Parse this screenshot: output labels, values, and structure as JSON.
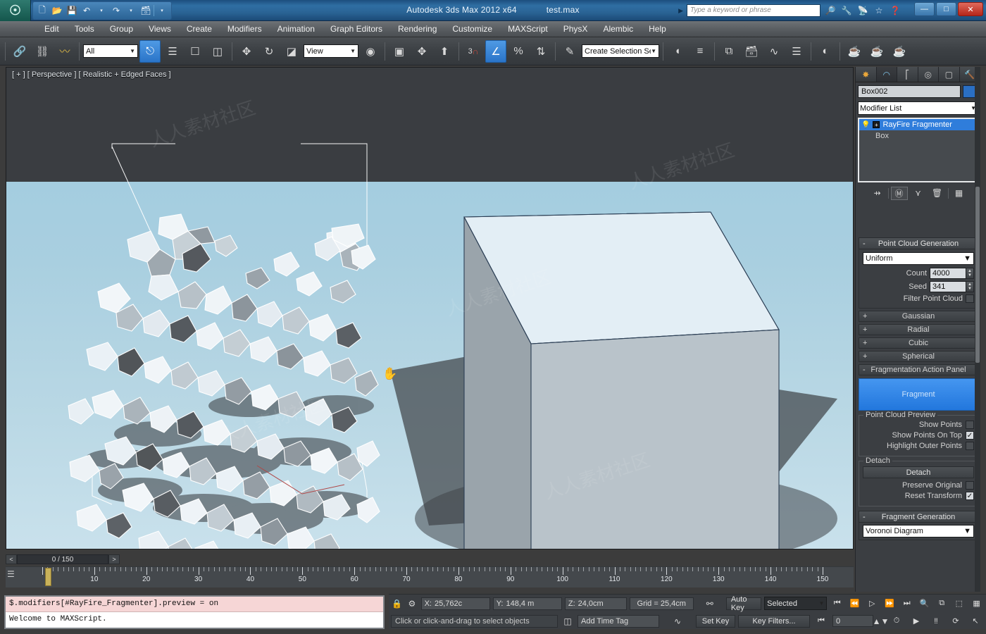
{
  "titlebar": {
    "app_title": "Autodesk 3ds Max  2012 x64",
    "file_name": "test.max",
    "logo": "3ds-max-logo",
    "search_placeholder": "Type a keyword or phrase",
    "quick_access": [
      {
        "name": "new-file-icon",
        "glyph": "⬜"
      },
      {
        "name": "open-file-icon",
        "glyph": "📂"
      },
      {
        "name": "save-file-icon",
        "glyph": "💾"
      },
      {
        "name": "undo-icon",
        "glyph": "↶"
      },
      {
        "name": "undo-dropdown-icon",
        "glyph": "▾"
      },
      {
        "name": "redo-icon",
        "glyph": "↷"
      },
      {
        "name": "redo-dropdown-icon",
        "glyph": "▾"
      },
      {
        "name": "project-folder-icon",
        "glyph": "🗂"
      },
      {
        "name": "qat-customize-icon",
        "glyph": "▾"
      }
    ],
    "title_icons": [
      {
        "name": "binoculars-icon",
        "glyph": "🔍"
      },
      {
        "name": "search-tools-icon",
        "glyph": "🔧"
      },
      {
        "name": "satellite-icon",
        "glyph": "📡"
      },
      {
        "name": "favorites-star-icon",
        "glyph": "★"
      },
      {
        "name": "help-icon",
        "glyph": "?"
      }
    ],
    "window_buttons": [
      {
        "name": "minimize-button",
        "glyph": "—"
      },
      {
        "name": "maximize-button",
        "glyph": "□"
      },
      {
        "name": "close-button",
        "glyph": "✕"
      }
    ]
  },
  "menubar": {
    "items": [
      "Edit",
      "Tools",
      "Group",
      "Views",
      "Create",
      "Modifiers",
      "Animation",
      "Graph Editors",
      "Rendering",
      "Customize",
      "MAXScript",
      "PhysX",
      "Alembic",
      "Help"
    ]
  },
  "toolbar": {
    "selection_filter": "All",
    "reference_coordinate": "View",
    "named_selection_set": "Create Selection Se",
    "snap_percent_label": "%",
    "snap_count_label": "3",
    "buttons": [
      {
        "name": "select-and-link-icon",
        "glyph": "🔗"
      },
      {
        "name": "unlink-selection-icon",
        "glyph": "⛓"
      },
      {
        "name": "bind-to-space-warp-icon",
        "glyph": "〰"
      },
      {
        "name": "select-object-icon",
        "glyph": "⬚",
        "active": true
      },
      {
        "name": "select-by-name-icon",
        "glyph": "☰"
      },
      {
        "name": "rectangular-selection-region-icon",
        "glyph": "⬚"
      },
      {
        "name": "window-crossing-icon",
        "glyph": "◫"
      },
      {
        "name": "select-and-move-icon",
        "glyph": "✥"
      },
      {
        "name": "select-and-rotate-icon",
        "glyph": "↻"
      },
      {
        "name": "select-and-scale-icon",
        "glyph": "◰"
      },
      {
        "name": "mirror-icon",
        "glyph": "◧"
      },
      {
        "name": "align-icon",
        "glyph": "✥"
      },
      {
        "name": "layer-manager-icon",
        "glyph": "⬆"
      },
      {
        "name": "snaps-toggle-icon",
        "glyph": "⌔"
      },
      {
        "name": "angle-snap-toggle-icon",
        "glyph": "∠",
        "active": true
      },
      {
        "name": "percent-snap-toggle-icon",
        "glyph": "⌕"
      },
      {
        "name": "spinner-snap-toggle-icon",
        "glyph": "↕"
      },
      {
        "name": "edit-named-selection-icon",
        "glyph": "✎"
      },
      {
        "name": "mirror-geometry-icon",
        "glyph": "◑"
      },
      {
        "name": "align-tools-icon",
        "glyph": "≡"
      },
      {
        "name": "layer-explorer-icon",
        "glyph": "⧉"
      },
      {
        "name": "scene-explorer-icon",
        "glyph": "🗂"
      },
      {
        "name": "curve-editor-icon",
        "glyph": "∿"
      },
      {
        "name": "schematic-view-icon",
        "glyph": "☰"
      },
      {
        "name": "material-editor-icon",
        "glyph": "◔"
      },
      {
        "name": "render-setup-icon",
        "glyph": "🫖"
      },
      {
        "name": "rendered-frame-window-icon",
        "glyph": "☕"
      },
      {
        "name": "render-production-icon",
        "glyph": "☕"
      }
    ]
  },
  "viewport": {
    "label": "[ + ] [ Perspective ] [ Realistic + Edged Faces ]",
    "cursor": "pan-hand-cursor",
    "sky_color": "#3a3d41",
    "ground_color": "#a9cfe0",
    "cube_top_color": "#e3eef5",
    "cube_front_color": "#b9c3ca",
    "cube_side_color": "#9aa4ab",
    "fragment_light": "#eef4f8",
    "fragment_mid": "#c2ccd3",
    "fragment_dark": "#55595e",
    "edge_color": "#ffffff"
  },
  "command_panel": {
    "tabs": [
      {
        "name": "create-tab",
        "glyph": "☀"
      },
      {
        "name": "modify-tab",
        "glyph": "◠"
      },
      {
        "name": "hierarchy-tab",
        "glyph": "⑂"
      },
      {
        "name": "motion-tab",
        "glyph": "◎"
      },
      {
        "name": "display-tab",
        "glyph": "▢"
      },
      {
        "name": "utilities-tab",
        "glyph": "🔨"
      }
    ],
    "object_name": "Box002",
    "modifier_list_label": "Modifier List",
    "stack": [
      {
        "label": "RayFire Fragmenter",
        "selected": true
      },
      {
        "label": "Box",
        "selected": false
      }
    ],
    "stack_tools": [
      {
        "name": "pin-stack-icon",
        "glyph": "⊸"
      },
      {
        "name": "show-end-result-icon",
        "glyph": "⌶"
      },
      {
        "name": "make-unique-icon",
        "glyph": "⑂"
      },
      {
        "name": "remove-modifier-icon",
        "glyph": "🗑"
      },
      {
        "name": "configure-modifier-sets-icon",
        "glyph": "▦"
      }
    ],
    "point_cloud": {
      "title": "Point Cloud Generation",
      "type": "Uniform",
      "count_label": "Count",
      "count_value": "4000",
      "seed_label": "Seed",
      "seed_value": "341",
      "filter_label": "Filter Point Cloud",
      "filter_checked": false
    },
    "sub_rollouts": [
      {
        "label": "Gaussian",
        "state": "+"
      },
      {
        "label": "Radial",
        "state": "+"
      },
      {
        "label": "Cubic",
        "state": "+"
      },
      {
        "label": "Spherical",
        "state": "+"
      }
    ],
    "action_panel": {
      "title": "Fragmentation Action Panel",
      "fragment_button": "Fragment"
    },
    "point_cloud_preview": {
      "title": "Point Cloud Preview",
      "rows": [
        {
          "label": "Show Points",
          "checked": false
        },
        {
          "label": "Show Points On Top",
          "checked": true
        },
        {
          "label": "Highlight Outer Points",
          "checked": false
        }
      ]
    },
    "detach": {
      "title": "Detach",
      "button": "Detach",
      "rows": [
        {
          "label": "Preserve Original",
          "checked": false
        },
        {
          "label": "Reset Transform",
          "checked": true
        }
      ]
    },
    "fragment_generation": {
      "title": "Fragment Generation",
      "type": "Voronoi Diagram"
    }
  },
  "timeline": {
    "frame_display": "0 / 150",
    "prev_glyph": "<",
    "next_glyph": ">",
    "current_frame": 0,
    "start": 0,
    "end": 150,
    "labels": [
      10,
      20,
      30,
      40,
      50,
      60,
      70,
      80,
      90,
      100,
      110,
      120,
      130,
      140,
      150
    ],
    "track_key_icon": "track-key-icon"
  },
  "listener": {
    "line1": "$.modifiers[#RayFire_Fragmenter].preview = on",
    "line2": "Welcome to MAXScript."
  },
  "statusbar": {
    "lock_icon": "lock-selection-icon",
    "selection_icon": "selection-lock-icon",
    "x_label": "X:",
    "x_value": "25,762c",
    "y_label": "Y:",
    "y_value": "148,4  m",
    "z_label": "Z:",
    "z_value": "24,0cm",
    "grid_label": "Grid = 25,4cm",
    "prompt": "Click or click-and-drag to select objects",
    "add_time_tag": "Add Time Tag",
    "key_mode_icon": "key-mode-icon",
    "auto_key": "Auto Key",
    "set_key": "Set Key",
    "key_filter_set": "Selected",
    "key_filters": "Key Filters...",
    "current_frame_field": "0",
    "playback": [
      {
        "name": "goto-start-button",
        "glyph": "⏮"
      },
      {
        "name": "previous-frame-button",
        "glyph": "⏪"
      },
      {
        "name": "play-animation-button",
        "glyph": "▷"
      },
      {
        "name": "next-frame-button",
        "glyph": "⏩"
      },
      {
        "name": "goto-end-button",
        "glyph": "⏭"
      }
    ],
    "viewnav": [
      {
        "name": "zoom-icon",
        "glyph": "🔍"
      },
      {
        "name": "zoom-all-icon",
        "glyph": "⧉"
      },
      {
        "name": "zoom-extents-icon",
        "glyph": "⬚"
      },
      {
        "name": "zoom-region-icon",
        "glyph": "▦"
      },
      {
        "name": "pan-icon",
        "glyph": "✋"
      },
      {
        "name": "orbit-icon",
        "glyph": "⟳"
      },
      {
        "name": "maximize-viewport-icon",
        "glyph": "↖"
      },
      {
        "name": "time-config-icon",
        "glyph": "⏱"
      },
      {
        "name": "key-mode-toggle-icon",
        "glyph": "⫽"
      }
    ]
  }
}
